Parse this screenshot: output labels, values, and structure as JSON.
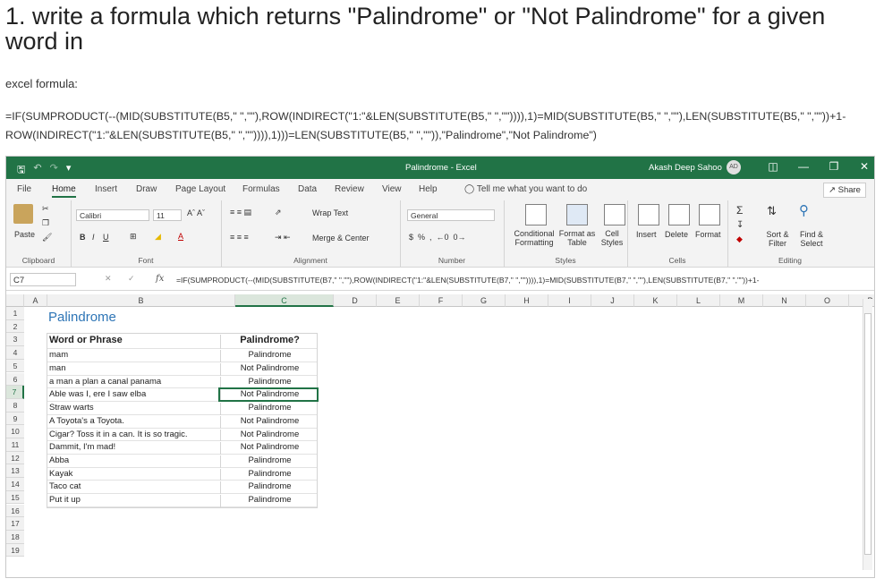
{
  "page": {
    "title": "1. write a formula which returns \"Palindrome\" or \"Not Palindrome\" for a given word in",
    "label": "excel formula:",
    "formula": "=IF(SUMPRODUCT(--(MID(SUBSTITUTE(B5,\" \",\"\"),ROW(INDIRECT(\"1:\"&LEN(SUBSTITUTE(B5,\" \",\"\")))),1)=MID(SUBSTITUTE(B5,\" \",\"\"),LEN(SUBSTITUTE(B5,\" \",\"\"))+1-ROW(INDIRECT(\"1:\"&LEN(SUBSTITUTE(B5,\" \",\"\")))),1)))=LEN(SUBSTITUTE(B5,\" \",\"\")),\"Palindrome\",\"Not Palindrome\")"
  },
  "excel": {
    "window_title": "Palindrome - Excel",
    "user_name": "Akash Deep Sahoo",
    "user_initials": "AD",
    "menu_tabs": [
      "File",
      "Home",
      "Insert",
      "Draw",
      "Page Layout",
      "Formulas",
      "Data",
      "Review",
      "View",
      "Help"
    ],
    "active_tab": "Home",
    "tell_me": "Tell me what you want to do",
    "share": "Share",
    "ribbon": {
      "paste": "Paste",
      "clipboard": "Clipboard",
      "font_name": "Calibri",
      "font_size": "11",
      "font": "Font",
      "wrap_text": "Wrap Text",
      "merge_center": "Merge & Center",
      "alignment": "Alignment",
      "number_format": "General",
      "number": "Number",
      "conditional_formatting": "Conditional Formatting",
      "format_as_table": "Format as Table",
      "cell_styles": "Cell Styles",
      "styles": "Styles",
      "insert": "Insert",
      "delete": "Delete",
      "format": "Format",
      "cells": "Cells",
      "sort_filter": "Sort & Filter",
      "find_select": "Find & Select",
      "editing": "Editing"
    },
    "name_box": "C7",
    "formula_bar": "=IF(SUMPRODUCT(--(MID(SUBSTITUTE(B7,\" \",\"\"),ROW(INDIRECT(\"1:\"&LEN(SUBSTITUTE(B7,\" \",\"\")))),1)=MID(SUBSTITUTE(B7,\" \",\"\"),LEN(SUBSTITUTE(B7,\" \",\"\"))+1-",
    "columns": [
      "A",
      "B",
      "C",
      "D",
      "E",
      "F",
      "G",
      "H",
      "I",
      "J",
      "K",
      "L",
      "M",
      "N",
      "O",
      "P"
    ],
    "rows": [
      "1",
      "2",
      "3",
      "4",
      "5",
      "6",
      "7",
      "8",
      "9",
      "10",
      "11",
      "12",
      "13",
      "14",
      "15",
      "16",
      "17",
      "18",
      "19"
    ],
    "sheet_title": "Palindrome",
    "table": {
      "header_b": "Word or Phrase",
      "header_c": "Palindrome?",
      "rows": [
        {
          "b": "mam",
          "c": "Palindrome"
        },
        {
          "b": "man",
          "c": "Not Palindrome"
        },
        {
          "b": "a man a plan a canal panama",
          "c": "Palindrome"
        },
        {
          "b": "Able was I, ere I saw elba",
          "c": "Not Palindrome"
        },
        {
          "b": "Straw warts",
          "c": "Palindrome"
        },
        {
          "b": "A Toyota's a Toyota.",
          "c": "Not Palindrome"
        },
        {
          "b": "Cigar? Toss it in a can. It is so tragic.",
          "c": "Not Palindrome"
        },
        {
          "b": "Dammit, I'm mad!",
          "c": "Not Palindrome"
        },
        {
          "b": "Abba",
          "c": "Palindrome"
        },
        {
          "b": "Kayak",
          "c": "Palindrome"
        },
        {
          "b": "Taco cat",
          "c": "Palindrome"
        },
        {
          "b": "Put it up",
          "c": "Palindrome"
        }
      ]
    },
    "colors": {
      "excel_green": "#217346",
      "title_blue": "#2e75b6"
    }
  }
}
